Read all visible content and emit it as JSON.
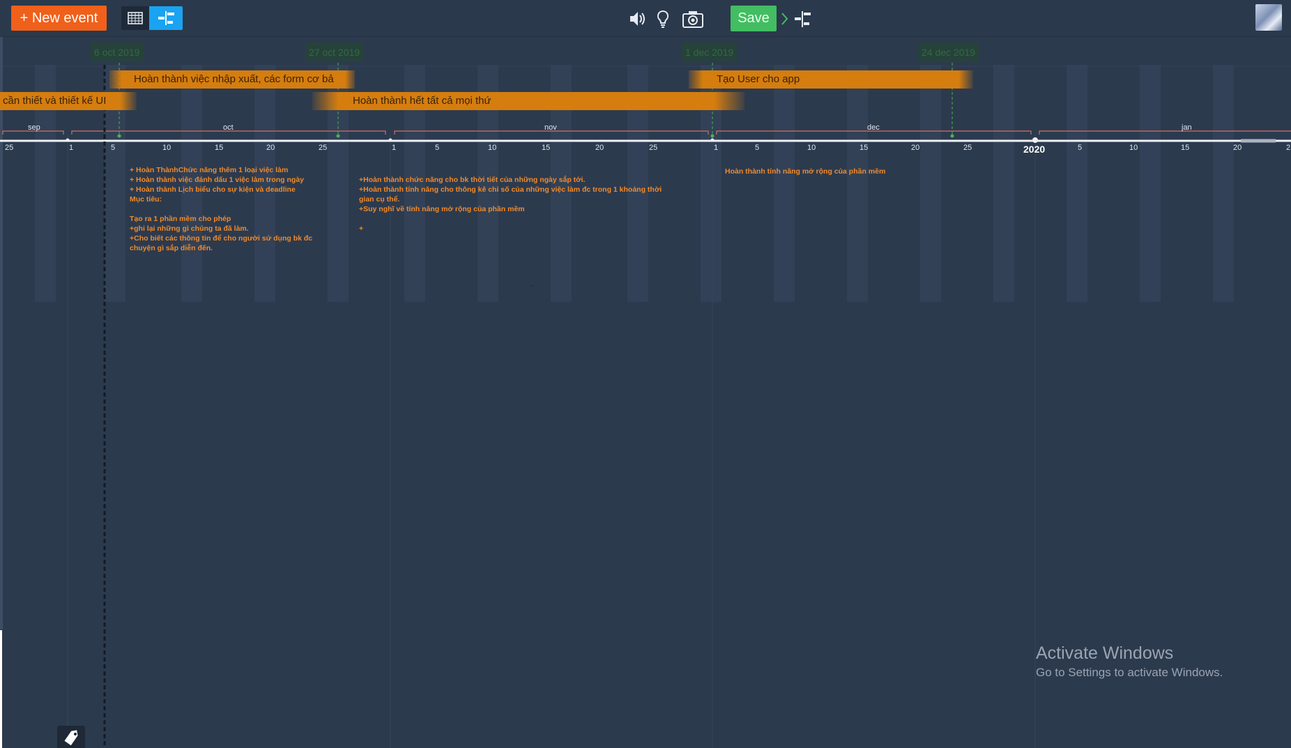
{
  "toolbar": {
    "new_event_label": "+ New event",
    "save_label": "Save",
    "icons": [
      "table-view-icon",
      "timeline-view-icon",
      "speaker-icon",
      "lightbulb-icon",
      "camera-icon",
      "timeline-layout-icon",
      "chevron-right-icon",
      "user-avatar"
    ]
  },
  "markers": [
    {
      "label": "6 oct 2019"
    },
    {
      "label": "27 oct 2019"
    },
    {
      "label": "1 dec 2019"
    },
    {
      "label": "24 dec 2019"
    }
  ],
  "events": [
    {
      "label": "Hoàn thành việc nhập xuất, các form cơ bả"
    },
    {
      "label": "cần thiết và thiết kế UI"
    },
    {
      "label": "Hoàn thành hết tất cả mọi thứ"
    },
    {
      "label": "Tạo User cho app"
    }
  ],
  "months": [
    "sep",
    "oct",
    "nov",
    "dec",
    "jan"
  ],
  "day_ticks": [
    "25",
    "1",
    "5",
    "10",
    "15",
    "20",
    "25",
    "1",
    "5",
    "10",
    "15",
    "20",
    "25",
    "1",
    "5",
    "10",
    "15",
    "20",
    "25",
    "5",
    "10",
    "15",
    "20",
    "2"
  ],
  "year_label": "2020",
  "notes": [
    {
      "text": "+ Hoàn ThànhChức năng thêm 1 loại việc làm\n+ Hoàn thành việc đánh dấu 1 việc làm trong ngày\n+ Hoàn thành Lịch biểu cho sự kiện và deadline\nMục tiêu:\n\nTạo ra 1 phần mềm cho phép\n+ghi lại những gì chúng ta đã làm.\n+Cho biết các thông tin để cho người sử dụng bk đc\nchuyện gì sắp diễn đến."
    },
    {
      "text": "+Hoàn thành chức năng cho bk thời tiết của những ngày sắp tới.\n+Hoàn thành  tính năng cho thông kê chỉ số của những việc làm đc trong 1 khoảng thời\ngian cụ thể.\n+Suy nghĩ về tính năng mở rộng của phần mềm\n\n+"
    },
    {
      "text": "Hoàn thành tính năng mở rộng của phần mềm"
    }
  ],
  "watermark": {
    "title": "Activate Windows",
    "subtitle": "Go to Settings to activate Windows."
  },
  "colors": {
    "background": "#2c3a4e",
    "accent_new": "#f0601a",
    "accent_view": "#1aa3f0",
    "save": "#43bd62",
    "event_bar": "#d57d0e",
    "notes_text": "#f08a2a",
    "marker": "#2f6b42"
  }
}
